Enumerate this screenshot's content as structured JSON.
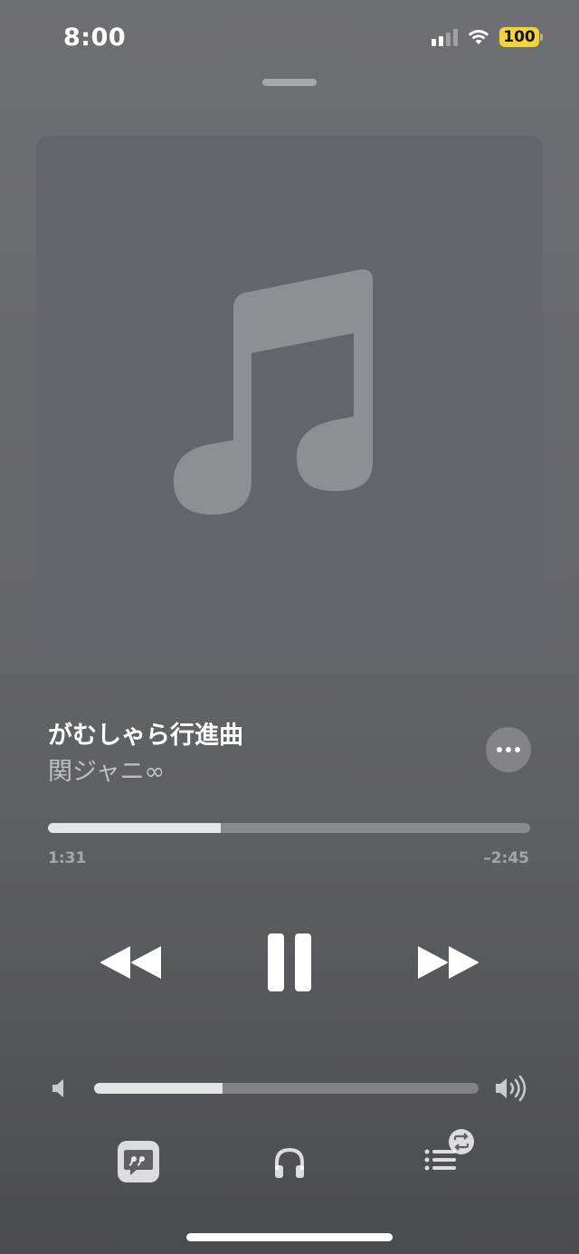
{
  "status_bar": {
    "time": "8:00",
    "battery_level": "100",
    "icons": [
      "signal-icon",
      "wifi-icon",
      "battery-icon"
    ]
  },
  "now_playing": {
    "artwork_icon": "music-note-icon",
    "title": "がむしゃら行進曲",
    "artist": "関ジャニ∞",
    "progress": 0.358,
    "elapsed": "1:31",
    "remaining": "–2:45"
  },
  "volume": {
    "level": 0.335
  },
  "controls": {
    "rewind_icon": "backward-icon",
    "pause_icon": "pause-icon",
    "forward_icon": "forward-icon",
    "more_icon": "ellipsis-icon"
  },
  "bottom_bar": {
    "lyrics_icon": "lyrics-icon",
    "airplay_icon": "headphones-icon",
    "queue_icon": "queue-icon"
  },
  "colors": {
    "battery": "#f2d33a",
    "background_top": "#6e6f73",
    "background_bottom": "#4b4c50"
  }
}
